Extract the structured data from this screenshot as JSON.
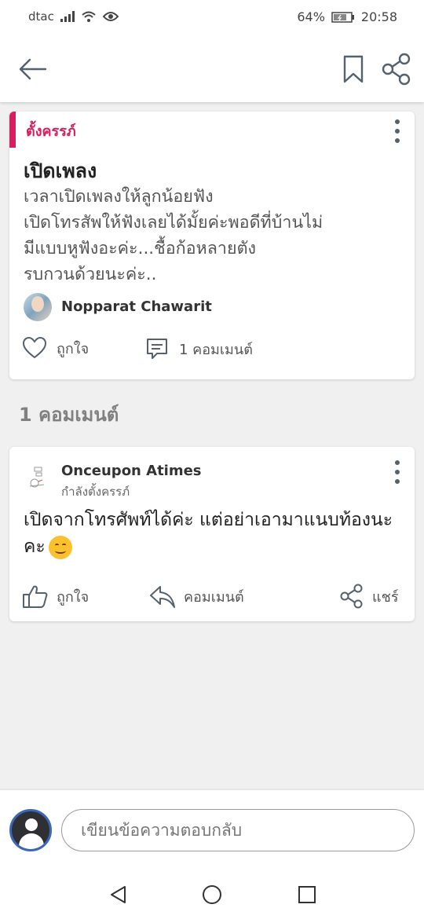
{
  "status_bar": {
    "carrier": "dtac",
    "battery": "64%",
    "time": "20:58"
  },
  "app_bar": {
    "back_icon": "arrow-left-icon",
    "bookmark_icon": "bookmark-icon",
    "share_icon": "share-icon"
  },
  "post": {
    "category": "ตั้งครรภ์",
    "title": "เปิดเพลง",
    "body_lines": [
      "เวลาเปิดเพลงให้ลูกน้อยฟัง",
      "เปิดโทรสัพให้ฟังเลยได้มั้ยค่ะพอดีที่บ้านไม่",
      "มีแบบหูฟังอะค่ะ...ชื้อก้อหลายตัง",
      "รบกวนด้วยนะค่ะ.."
    ],
    "author": "Nopparat Chawarit",
    "like_label": "ถูกใจ",
    "comment_count_label": "1 คอมเมนต์"
  },
  "comments_section": {
    "heading": "1 คอมเมนต์"
  },
  "comment": {
    "name": "Onceupon Atimes",
    "subtitle": "กำลังตั้งครรภ์",
    "text": "เปิดจากโทรศัพท์ได้ค่ะ แต่อย่าเอามาแนบท้องนะคะ",
    "emoji": "smiling-face-emoji",
    "like_label": "ถูกใจ",
    "reply_label": "คอมเมนต์",
    "share_label": "แชร์"
  },
  "composer": {
    "placeholder": "เขียนข้อความตอบกลับ"
  },
  "colors": {
    "accent": "#d61f5c",
    "icon": "#55616d",
    "background": "#f0f0f0"
  }
}
